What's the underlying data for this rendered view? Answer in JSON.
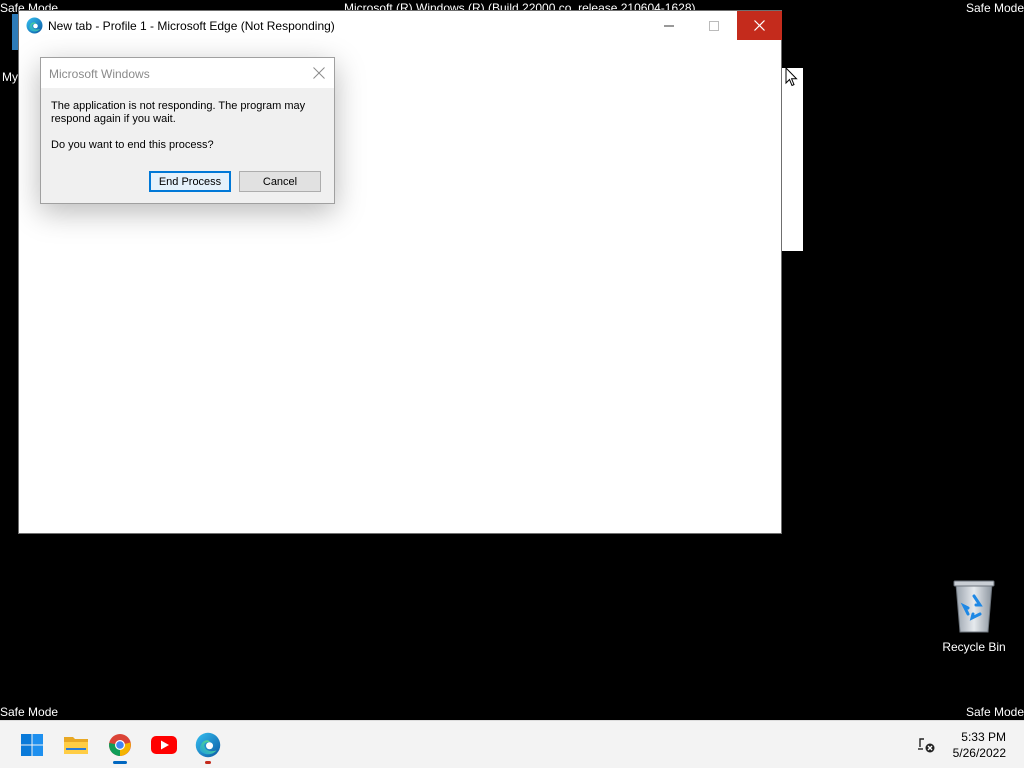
{
  "overlay": {
    "safe_mode_top_left": "Safe Mode",
    "safe_mode_top_right": "Safe Mode",
    "safe_mode_bottom_left": "Safe Mode",
    "safe_mode_bottom_right": "Safe Mode",
    "build_text": "Microsoft (R) Windows (R) (Build 22000.co_release.210604-1628)"
  },
  "desktop": {
    "partial_label": "My",
    "recycle_bin_label": "Recycle Bin"
  },
  "edge_window": {
    "title": "New tab - Profile 1 - Microsoft Edge (Not Responding)",
    "icon": "edge-icon",
    "close_color": "#c42b1c"
  },
  "dialog": {
    "title": "Microsoft Windows",
    "message": "The application is not responding. The program may respond again if you wait.",
    "question": "Do you want to end this process?",
    "end_process_label": "End Process",
    "cancel_label": "Cancel"
  },
  "taskbar": {
    "items": [
      {
        "name": "start",
        "icon": "windows-start-icon"
      },
      {
        "name": "file-explorer",
        "icon": "folder-icon"
      },
      {
        "name": "chrome",
        "icon": "chrome-icon",
        "running": true
      },
      {
        "name": "youtube",
        "icon": "youtube-icon"
      },
      {
        "name": "edge",
        "icon": "edge-icon",
        "running": true
      }
    ],
    "time": "5:33 PM",
    "date": "5/26/2022",
    "accent_color": "#0067c0"
  }
}
